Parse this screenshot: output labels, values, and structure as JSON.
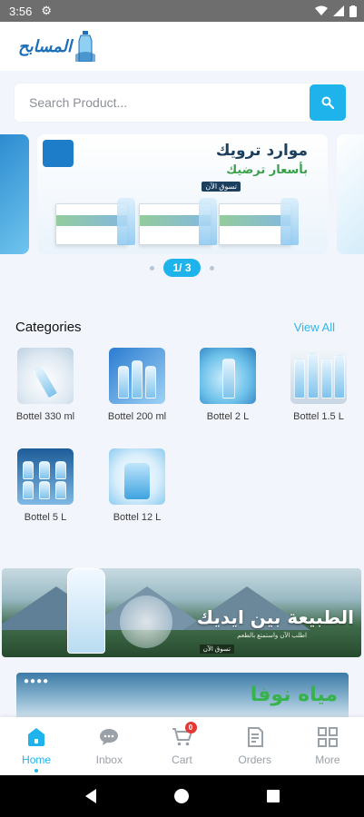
{
  "status_bar": {
    "time": "3:56"
  },
  "header": {
    "logo_text": "المسابح"
  },
  "search": {
    "placeholder": "Search Product..."
  },
  "carousel": {
    "main_title": "موارد ترويك",
    "main_subtitle": "بأسعار ترضيك",
    "main_tag": "تسوق الآن",
    "indicator": "1/ 3"
  },
  "categories": {
    "title": "Categories",
    "view_all": "View All",
    "items": [
      {
        "label": "Bottel 330 ml"
      },
      {
        "label": "Bottel 200 ml"
      },
      {
        "label": "Bottel 2 L"
      },
      {
        "label": "Bottel 1.5 L"
      },
      {
        "label": "Bottel 5 L"
      },
      {
        "label": "Bottel 12 L"
      }
    ]
  },
  "banners": {
    "nature_title": "الطبيعة بين ايديك",
    "nature_subtitle": "اطلب الآن واستمتع بالطعم",
    "nature_tag": "تسوق الآن",
    "nova_title": "مياه نوفا"
  },
  "bottom_nav": {
    "items": [
      {
        "label": "Home"
      },
      {
        "label": "Inbox"
      },
      {
        "label": "Cart"
      },
      {
        "label": "Orders"
      },
      {
        "label": "More"
      }
    ],
    "cart_count": "0"
  },
  "colors": {
    "accent": "#1fb3ec",
    "badge": "#e53935"
  }
}
